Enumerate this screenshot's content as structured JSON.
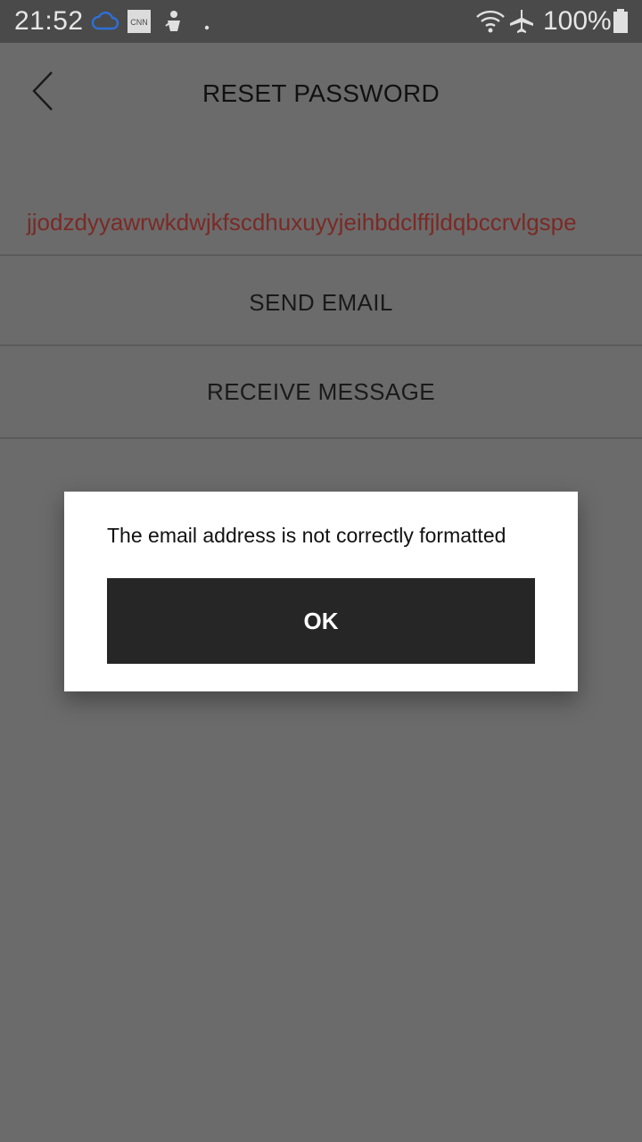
{
  "status_bar": {
    "time": "21:52",
    "battery": "100%",
    "icons": [
      "cloud-icon",
      "cnn-icon",
      "game-icon",
      "dot-icon",
      "wifi-icon",
      "airplane-icon",
      "battery-icon"
    ]
  },
  "header": {
    "title": "RESET PASSWORD",
    "back_icon": "chevron-left-icon"
  },
  "form": {
    "email_value": "jjodzdyyawrwkdwjkfscdhuxuyyjeihbdclffjldqbccrvlgspe"
  },
  "actions": {
    "send_email": "SEND EMAIL",
    "receive_message": "RECEIVE MESSAGE"
  },
  "dialog": {
    "message": "The email address is not correctly formatted",
    "ok_label": "OK"
  },
  "colors": {
    "background": "#6b6b6b",
    "status_bar": "#4a4a4a",
    "email_error": "#7a2a26",
    "dialog_button": "#262626"
  }
}
